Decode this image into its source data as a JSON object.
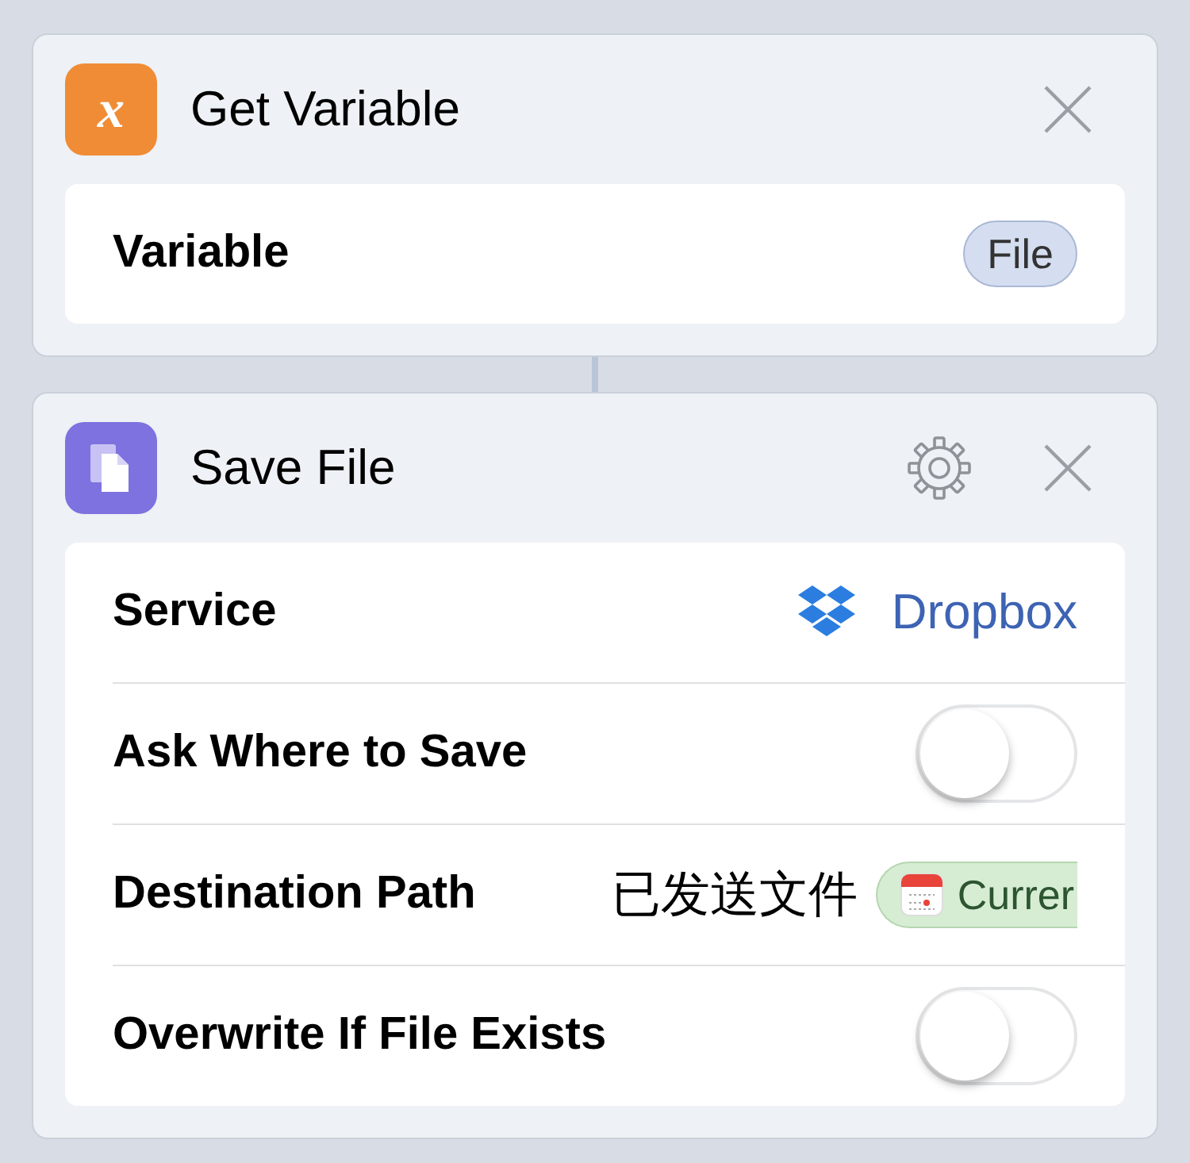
{
  "actions": [
    {
      "kind": "variable",
      "icon_text": "x",
      "title": "Get Variable",
      "has_settings": false,
      "rows": [
        {
          "kind": "token",
          "label": "Variable",
          "value": "File"
        }
      ]
    },
    {
      "kind": "file",
      "title": "Save File",
      "has_settings": true,
      "rows": [
        {
          "kind": "service",
          "label": "Service",
          "value": "Dropbox"
        },
        {
          "kind": "toggle",
          "label": "Ask Where to Save",
          "on": false
        },
        {
          "kind": "path",
          "label": "Destination Path",
          "value": "已发送文件",
          "token": "Currer"
        },
        {
          "kind": "toggle",
          "label": "Overwrite If File Exists",
          "on": false
        }
      ]
    }
  ]
}
